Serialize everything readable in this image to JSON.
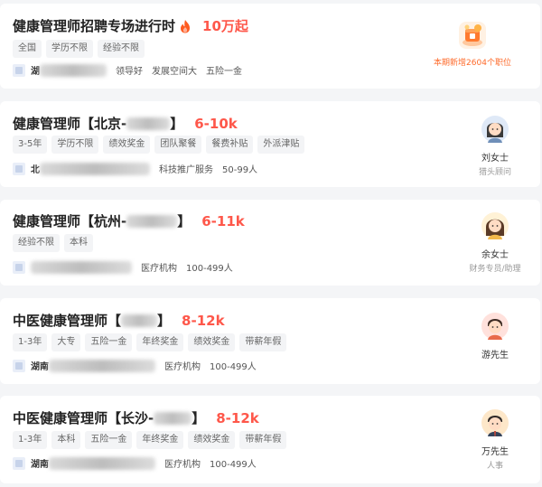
{
  "jobs": [
    {
      "title": "健康管理师招聘专场进行时",
      "salary": "10万起",
      "tags": [
        "全国",
        "学历不限",
        "经验不限"
      ],
      "company_blurred": "湖",
      "details": [
        "领导好",
        "发展空间大",
        "五险一金"
      ],
      "promo_text": "本期新增2604个职位"
    },
    {
      "title": "健康管理师【北京-",
      "title_end": "】",
      "salary": "6-10k",
      "tags": [
        "3-5年",
        "学历不限",
        "绩效奖金",
        "团队聚餐",
        "餐费补贴",
        "外派津贴"
      ],
      "company_blurred": "北",
      "details": [
        "科技推广服务",
        "50-99人"
      ],
      "contact_name": "刘女士",
      "contact_role": "猎头顾问"
    },
    {
      "title": "健康管理师【杭州-",
      "title_end": "】",
      "salary": "6-11k",
      "tags": [
        "经验不限",
        "本科"
      ],
      "company_blurred": "",
      "details": [
        "医疗机构",
        "100-499人"
      ],
      "contact_name": "余女士",
      "contact_role": "财务专员/助理"
    },
    {
      "title": "中医健康管理师【",
      "title_end": "】",
      "salary": "8-12k",
      "tags": [
        "1-3年",
        "大专",
        "五险一金",
        "年终奖金",
        "绩效奖金",
        "带薪年假"
      ],
      "company_blurred": "湖南",
      "details": [
        "医疗机构",
        "100-499人"
      ],
      "contact_name": "游先生",
      "contact_role": ""
    },
    {
      "title": "中医健康管理师【长沙-",
      "title_end": "】",
      "salary": "8-12k",
      "tags": [
        "1-3年",
        "本科",
        "五险一金",
        "年终奖金",
        "绩效奖金",
        "带薪年假"
      ],
      "company_blurred": "湖南",
      "details": [
        "医疗机构",
        "100-499人"
      ],
      "contact_name": "万先生",
      "contact_role": "人事"
    }
  ],
  "icons": {
    "flame": "flame-icon",
    "promo": "promo-badge-icon",
    "company_logo": "company-logo-icon"
  },
  "colors": {
    "salary": "#fe574a",
    "promo_text": "#fe6a2a",
    "background": "#f4f5f7"
  }
}
